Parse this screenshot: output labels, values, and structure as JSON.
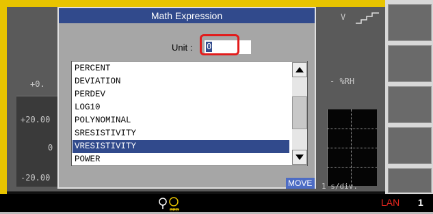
{
  "screen": {
    "top_right_unit": "V",
    "left_value": "+0.",
    "right_unit": "- %RH",
    "y_axis_ticks": [
      "+20.00",
      "0",
      "-20.00"
    ],
    "x_scale": "1 s/div."
  },
  "dialog": {
    "title": "Math Expression",
    "unit_label": "Unit :",
    "unit_value": "0",
    "options": [
      "PERCENT",
      "DEVIATION",
      "PERDEV",
      "LOG10",
      "POLYNOMINAL",
      "SRESISTIVITY",
      "VRESISTIVITY",
      "POWER"
    ],
    "selected_option": "VRESISTIVITY",
    "move_label": "MOVE"
  },
  "status": {
    "lan_label": "LAN",
    "lan_number": "1",
    "trigger_icon": "trigger-grd-icon"
  },
  "colors": {
    "accent": "#314a8c",
    "highlight": "#e21b1b",
    "bezel": "#e8c400"
  }
}
